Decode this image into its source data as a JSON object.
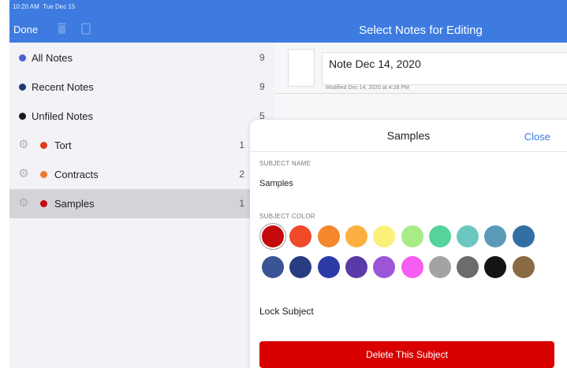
{
  "status_bar": {
    "time": "10:20 AM",
    "date": "Tue Dec 15"
  },
  "toolbar": {
    "done_label": "Done",
    "title": "Select Notes for Editing"
  },
  "sidebar": {
    "items": [
      {
        "label": "All Notes",
        "count": "9",
        "dot_color": "#4a5fd6"
      },
      {
        "label": "Recent Notes",
        "count": "9",
        "dot_color": "#1f3a78"
      },
      {
        "label": "Unfiled Notes",
        "count": "5",
        "dot_color": "#1a1a1a"
      },
      {
        "label": "Tort",
        "count": "1",
        "dot_color": "#e03a1e"
      },
      {
        "label": "Contracts",
        "count": "2",
        "dot_color": "#f0782c"
      },
      {
        "label": "Samples",
        "count": "1",
        "dot_color": "#c40a14"
      }
    ]
  },
  "notes": {
    "item": {
      "title": "Note Dec 14, 2020",
      "modified": "Modified Dec 14, 2020 at 4:28 PM"
    }
  },
  "panel": {
    "title": "Samples",
    "close_label": "Close",
    "subject_name_label": "SUBJECT NAME",
    "subject_name": "Samples",
    "subject_color_label": "SUBJECT COLOR",
    "lock_label": "Lock Subject",
    "delete_label": "Delete This Subject",
    "selected_color": "#c40a0a",
    "colors": [
      "#c40a0a",
      "#f04a2a",
      "#f5882c",
      "#fbb040",
      "#fbf07a",
      "#a8ec86",
      "#55d49c",
      "#6cc7c0",
      "#5a9ab8",
      "#336fa5",
      "#3a5595",
      "#283c82",
      "#2c3aa8",
      "#5a3aa6",
      "#9b55d6",
      "#f55ef0",
      "#a3a3a3",
      "#6c6c6c",
      "#141414",
      "#8a6a45"
    ]
  }
}
